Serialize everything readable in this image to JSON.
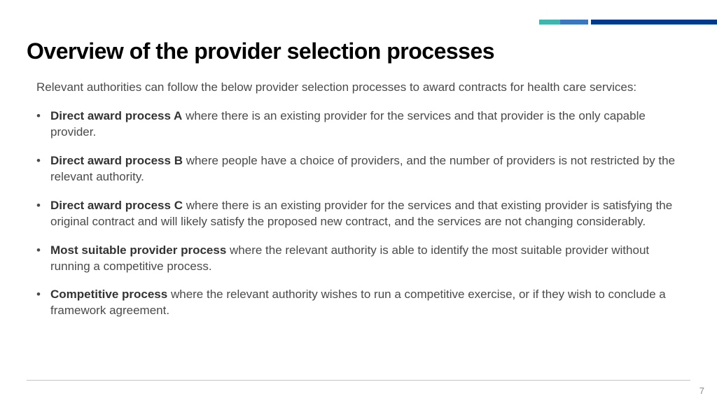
{
  "header": {
    "title": "Overview of the provider selection processes"
  },
  "intro": "Relevant authorities can follow the below provider selection processes to award contracts for health care services:",
  "bullets": [
    {
      "lead": "Direct award process A",
      "rest": " where there is an existing provider for the services and that provider is the only capable provider."
    },
    {
      "lead": "Direct award process B",
      "rest": " where people have a choice of providers, and the number of providers is not restricted by the relevant authority."
    },
    {
      "lead": "Direct award process C",
      "rest": " where there is an existing provider for the services and that existing provider is satisfying the original contract and will likely satisfy the proposed new contract, and the services are not changing considerably."
    },
    {
      "lead": "Most suitable provider process",
      "rest": " where the relevant authority is able to identify the most suitable provider without running a competitive process."
    },
    {
      "lead": "Competitive process",
      "rest": " where the relevant authority wishes to run a competitive exercise, or if they wish to conclude a framework agreement."
    }
  ],
  "page_number": "7"
}
